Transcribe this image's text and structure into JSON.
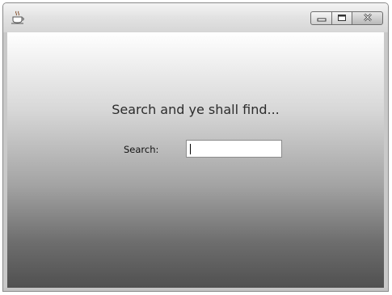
{
  "window": {
    "app_icon": "java-coffee-cup-icon",
    "buttons": {
      "minimize_icon": "minimize-icon",
      "maximize_icon": "maximize-icon",
      "close_icon": "close-icon"
    }
  },
  "main": {
    "heading": "Search and ye shall find...",
    "search_label": "Search:",
    "search_value": ""
  }
}
